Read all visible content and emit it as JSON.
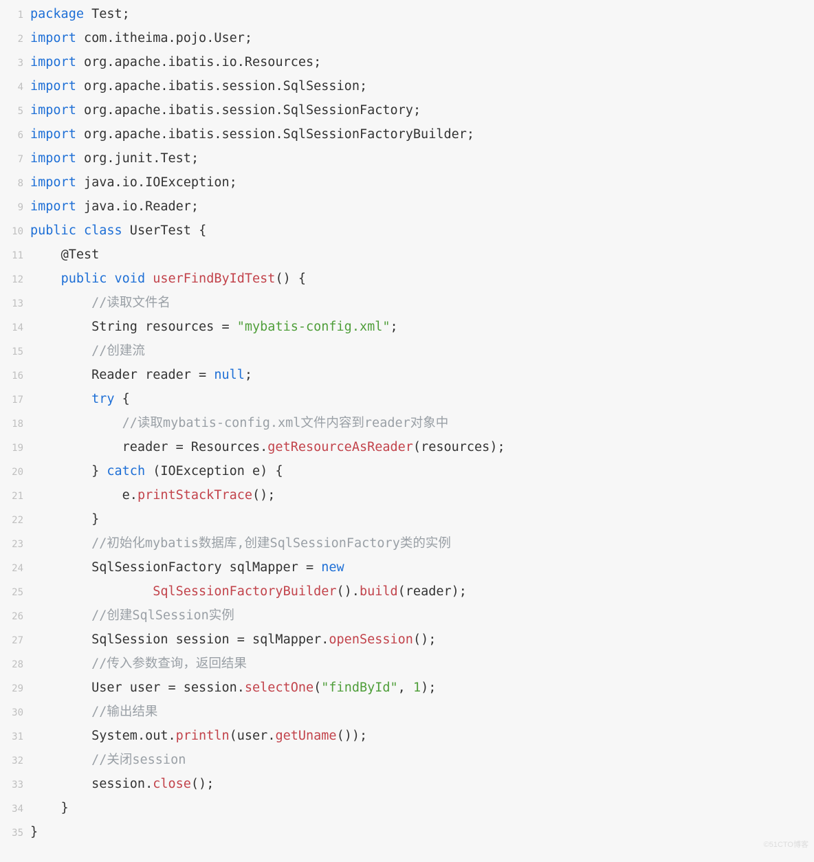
{
  "watermark": "©51CTO博客",
  "lines": [
    {
      "n": 1,
      "tokens": [
        [
          "kw",
          "package"
        ],
        [
          "",
          ""
        ],
        [
          "type",
          " Test"
        ],
        [
          "",
          ";"
        ]
      ]
    },
    {
      "n": 2,
      "tokens": [
        [
          "kw",
          "import"
        ],
        [
          "type",
          " com"
        ],
        [
          "",
          ". "
        ],
        [
          "type",
          "itheima"
        ],
        [
          "",
          ". "
        ],
        [
          "type",
          "pojo"
        ],
        [
          "",
          ". "
        ],
        [
          "type",
          "User"
        ],
        [
          "",
          ";"
        ]
      ]
    },
    {
      "n": 3,
      "tokens": [
        [
          "kw",
          "import"
        ],
        [
          "type",
          " org"
        ],
        [
          "",
          ". "
        ],
        [
          "type",
          "apache"
        ],
        [
          "",
          ". "
        ],
        [
          "type",
          "ibatis"
        ],
        [
          "",
          ". "
        ],
        [
          "type",
          "io"
        ],
        [
          "",
          ". "
        ],
        [
          "type",
          "Resources"
        ],
        [
          "",
          ";"
        ]
      ]
    },
    {
      "n": 4,
      "tokens": [
        [
          "kw",
          "import"
        ],
        [
          "type",
          " org"
        ],
        [
          "",
          ". "
        ],
        [
          "type",
          "apache"
        ],
        [
          "",
          ". "
        ],
        [
          "type",
          "ibatis"
        ],
        [
          "",
          ". "
        ],
        [
          "type",
          "session"
        ],
        [
          "",
          ". "
        ],
        [
          "type",
          "SqlSession"
        ],
        [
          "",
          ";"
        ]
      ]
    },
    {
      "n": 5,
      "tokens": [
        [
          "kw",
          "import"
        ],
        [
          "type",
          " org"
        ],
        [
          "",
          ". "
        ],
        [
          "type",
          "apache"
        ],
        [
          "",
          ". "
        ],
        [
          "type",
          "ibatis"
        ],
        [
          "",
          ". "
        ],
        [
          "type",
          "session"
        ],
        [
          "",
          ". "
        ],
        [
          "type",
          "SqlSessionFactory"
        ],
        [
          "",
          ";"
        ]
      ]
    },
    {
      "n": 6,
      "tokens": [
        [
          "kw",
          "import"
        ],
        [
          "type",
          " org"
        ],
        [
          "",
          ". "
        ],
        [
          "type",
          "apache"
        ],
        [
          "",
          ". "
        ],
        [
          "type",
          "ibatis"
        ],
        [
          "",
          ". "
        ],
        [
          "type",
          "session"
        ],
        [
          "",
          ". "
        ],
        [
          "type",
          "SqlSessionFactoryBuilder"
        ],
        [
          "",
          ";"
        ]
      ]
    },
    {
      "n": 7,
      "tokens": [
        [
          "kw",
          "import"
        ],
        [
          "type",
          " org"
        ],
        [
          "",
          ". "
        ],
        [
          "type",
          "junit"
        ],
        [
          "",
          ". "
        ],
        [
          "type",
          "Test"
        ],
        [
          "",
          ";"
        ]
      ]
    },
    {
      "n": 8,
      "tokens": [
        [
          "kw",
          "import"
        ],
        [
          "type",
          " java"
        ],
        [
          "",
          ". "
        ],
        [
          "type",
          "io"
        ],
        [
          "",
          ". "
        ],
        [
          "type",
          "IOException"
        ],
        [
          "",
          ";"
        ]
      ]
    },
    {
      "n": 9,
      "tokens": [
        [
          "kw",
          "import"
        ],
        [
          "type",
          " java"
        ],
        [
          "",
          ". "
        ],
        [
          "type",
          "io"
        ],
        [
          "",
          ". "
        ],
        [
          "type",
          "Reader"
        ],
        [
          "",
          ";"
        ]
      ]
    },
    {
      "n": 10,
      "tokens": [
        [
          "kw",
          "public"
        ],
        [
          "",
          " "
        ],
        [
          "kw",
          "class"
        ],
        [
          "type",
          " UserTest "
        ],
        [
          "",
          "{"
        ]
      ]
    },
    {
      "n": 11,
      "tokens": [
        [
          "",
          "    "
        ],
        [
          "annot",
          "@Test"
        ]
      ]
    },
    {
      "n": 12,
      "tokens": [
        [
          "",
          "    "
        ],
        [
          "kw",
          "public"
        ],
        [
          "",
          " "
        ],
        [
          "kw",
          "void"
        ],
        [
          "",
          " "
        ],
        [
          "method",
          "userFindByIdTest"
        ],
        [
          "",
          "() {"
        ]
      ]
    },
    {
      "n": 13,
      "tokens": [
        [
          "",
          "        "
        ],
        [
          "comment",
          "//读取文件名"
        ]
      ]
    },
    {
      "n": 14,
      "tokens": [
        [
          "",
          "        "
        ],
        [
          "type",
          "String resources "
        ],
        [
          "",
          "= "
        ],
        [
          "string",
          "\"mybatis-config.xml\""
        ],
        [
          "",
          ";"
        ]
      ]
    },
    {
      "n": 15,
      "tokens": [
        [
          "",
          "        "
        ],
        [
          "comment",
          "//创建流"
        ]
      ]
    },
    {
      "n": 16,
      "tokens": [
        [
          "",
          "        "
        ],
        [
          "type",
          "Reader reader "
        ],
        [
          "",
          "= "
        ],
        [
          "kw",
          "null"
        ],
        [
          "",
          ";"
        ]
      ]
    },
    {
      "n": 17,
      "tokens": [
        [
          "",
          "        "
        ],
        [
          "kw",
          "try"
        ],
        [
          "",
          " {"
        ]
      ]
    },
    {
      "n": 18,
      "tokens": [
        [
          "",
          "            "
        ],
        [
          "comment",
          "//读取mybatis-config.xml文件内容到reader对象中"
        ]
      ]
    },
    {
      "n": 19,
      "tokens": [
        [
          "",
          "            "
        ],
        [
          "type",
          "reader "
        ],
        [
          "",
          "= "
        ],
        [
          "type",
          "Resources"
        ],
        [
          "",
          ". "
        ],
        [
          "method",
          "getResourceAsReader"
        ],
        [
          "",
          "("
        ],
        [
          "type",
          "resources"
        ],
        [
          "",
          ");"
        ]
      ]
    },
    {
      "n": 20,
      "tokens": [
        [
          "",
          "        } "
        ],
        [
          "kw",
          "catch"
        ],
        [
          "",
          " ("
        ],
        [
          "type",
          "IOException e"
        ],
        [
          "",
          ") {"
        ]
      ]
    },
    {
      "n": 21,
      "tokens": [
        [
          "",
          "            "
        ],
        [
          "type",
          "e"
        ],
        [
          "",
          ". "
        ],
        [
          "method",
          "printStackTrace"
        ],
        [
          "",
          "();"
        ]
      ]
    },
    {
      "n": 22,
      "tokens": [
        [
          "",
          "        }"
        ]
      ]
    },
    {
      "n": 23,
      "tokens": [
        [
          "",
          "        "
        ],
        [
          "comment",
          "//初始化mybatis数据库,创建SqlSessionFactory类的实例"
        ]
      ]
    },
    {
      "n": 24,
      "tokens": [
        [
          "",
          "        "
        ],
        [
          "type",
          "SqlSessionFactory sqlMapper "
        ],
        [
          "",
          "= "
        ],
        [
          "kw",
          "new"
        ]
      ]
    },
    {
      "n": 25,
      "tokens": [
        [
          "",
          "                "
        ],
        [
          "method",
          "SqlSessionFactoryBuilder"
        ],
        [
          "",
          "(). "
        ],
        [
          "method",
          "build"
        ],
        [
          "",
          "("
        ],
        [
          "type",
          "reader"
        ],
        [
          "",
          ");"
        ]
      ]
    },
    {
      "n": 26,
      "tokens": [
        [
          "",
          "        "
        ],
        [
          "comment",
          "//创建SqlSession实例"
        ]
      ]
    },
    {
      "n": 27,
      "tokens": [
        [
          "",
          "        "
        ],
        [
          "type",
          "SqlSession session "
        ],
        [
          "",
          "= "
        ],
        [
          "type",
          "sqlMapper"
        ],
        [
          "",
          ". "
        ],
        [
          "method",
          "openSession"
        ],
        [
          "",
          "();"
        ]
      ]
    },
    {
      "n": 28,
      "tokens": [
        [
          "",
          "        "
        ],
        [
          "comment",
          "//传入参数查询，返回结果"
        ]
      ]
    },
    {
      "n": 29,
      "tokens": [
        [
          "",
          "        "
        ],
        [
          "type",
          "User user "
        ],
        [
          "",
          "= "
        ],
        [
          "type",
          "session"
        ],
        [
          "",
          ". "
        ],
        [
          "method",
          "selectOne"
        ],
        [
          "",
          "("
        ],
        [
          "string",
          "\"findById\""
        ],
        [
          "",
          ", "
        ],
        [
          "num",
          "1"
        ],
        [
          "",
          ");"
        ]
      ]
    },
    {
      "n": 30,
      "tokens": [
        [
          "",
          "        "
        ],
        [
          "comment",
          "//输出结果"
        ]
      ]
    },
    {
      "n": 31,
      "tokens": [
        [
          "",
          "        "
        ],
        [
          "type",
          "System"
        ],
        [
          "",
          ". "
        ],
        [
          "type",
          "out"
        ],
        [
          "",
          ". "
        ],
        [
          "method",
          "println"
        ],
        [
          "",
          "("
        ],
        [
          "type",
          "user"
        ],
        [
          "",
          ". "
        ],
        [
          "method",
          "getUname"
        ],
        [
          "",
          "());"
        ]
      ]
    },
    {
      "n": 32,
      "tokens": [
        [
          "",
          "        "
        ],
        [
          "comment",
          "//关闭session"
        ]
      ]
    },
    {
      "n": 33,
      "tokens": [
        [
          "",
          "        "
        ],
        [
          "type",
          "session"
        ],
        [
          "",
          ". "
        ],
        [
          "method",
          "close"
        ],
        [
          "",
          "();"
        ]
      ]
    },
    {
      "n": 34,
      "tokens": [
        [
          "",
          "    }"
        ]
      ]
    },
    {
      "n": 35,
      "tokens": [
        [
          "",
          "}"
        ]
      ]
    }
  ]
}
